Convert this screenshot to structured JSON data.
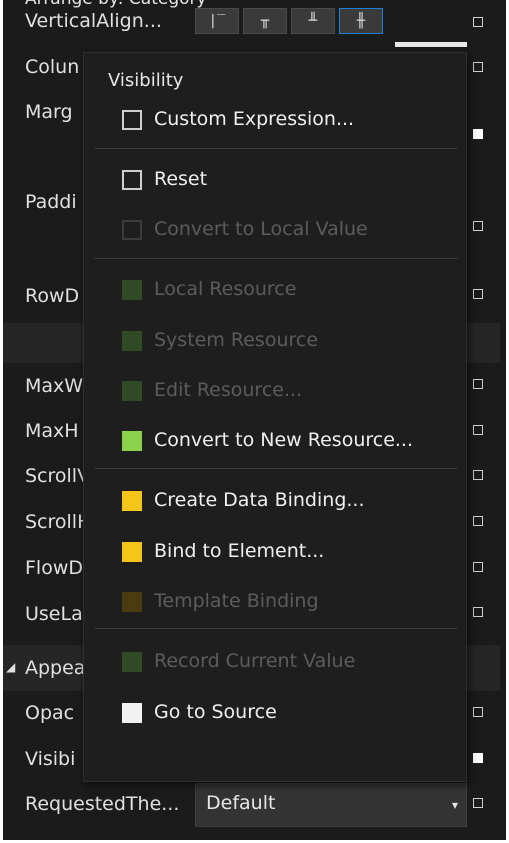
{
  "section_header_top": "Arrange by: Category",
  "section_appearance": "Appearance",
  "properties": [
    {
      "label": "VerticalAlign..."
    },
    {
      "label": "Colun"
    },
    {
      "label": "Marg"
    },
    {
      "label": "Paddi"
    },
    {
      "label": "RowD"
    },
    {
      "label": "MaxW"
    },
    {
      "label": "MaxH"
    },
    {
      "label": "ScrollV"
    },
    {
      "label": "ScrollH"
    },
    {
      "label": "FlowD"
    },
    {
      "label": "UseLa"
    },
    {
      "label": "Opac"
    },
    {
      "label": "Visibi"
    },
    {
      "label": "RequestedThe..."
    }
  ],
  "vertical_align_buttons": [
    {
      "glyph": "|‾",
      "icon": "align-top-icon"
    },
    {
      "glyph": "╥",
      "icon": "align-center-icon"
    },
    {
      "glyph": "╨",
      "icon": "align-bottom-icon"
    },
    {
      "glyph": "╫",
      "icon": "align-stretch-icon"
    }
  ],
  "requested_theme": {
    "value": "Default",
    "arrow": "▾"
  },
  "expand_glyph": "◢",
  "menu": {
    "header": "Visibility",
    "items": [
      {
        "label": "Custom Expression...",
        "enabled": true,
        "box_color": "",
        "box_border": "#cfcfcf"
      },
      {
        "label": "Reset",
        "enabled": true,
        "box_color": "",
        "box_border": "#cfcfcf"
      },
      {
        "label": "Convert to Local Value",
        "enabled": false,
        "box_color": "",
        "box_border": "#3c3c3c"
      },
      {
        "label": "Local Resource",
        "enabled": false,
        "box_color": "#2f4a24",
        "box_border": "#2f4a24"
      },
      {
        "label": "System Resource",
        "enabled": false,
        "box_color": "#2f4a24",
        "box_border": "#2f4a24"
      },
      {
        "label": "Edit Resource...",
        "enabled": false,
        "box_color": "#2f4a24",
        "box_border": "#2f4a24"
      },
      {
        "label": "Convert to New Resource...",
        "enabled": true,
        "box_color": "#8bd14a",
        "box_border": "#8bd14a"
      },
      {
        "label": "Create Data Binding...",
        "enabled": true,
        "box_color": "#f5c518",
        "box_border": "#f5c518"
      },
      {
        "label": "Bind to Element...",
        "enabled": true,
        "box_color": "#f5c518",
        "box_border": "#f5c518"
      },
      {
        "label": "Template Binding",
        "enabled": false,
        "box_color": "#4a3c10",
        "box_border": "#4a3c10"
      },
      {
        "label": "Record Current Value",
        "enabled": false,
        "box_color": "#2f4a24",
        "box_border": "#2f4a24"
      },
      {
        "label": "Go to Source",
        "enabled": true,
        "box_color": "#f2f2f2",
        "box_border": "#f2f2f2"
      }
    ]
  },
  "colors": {
    "panel_bg": "#1b1b1b",
    "menu_bg": "#1e1e1e",
    "accent_blue": "#1e7fd8",
    "resource_green": "#8bd14a",
    "binding_yellow": "#f5c518"
  }
}
